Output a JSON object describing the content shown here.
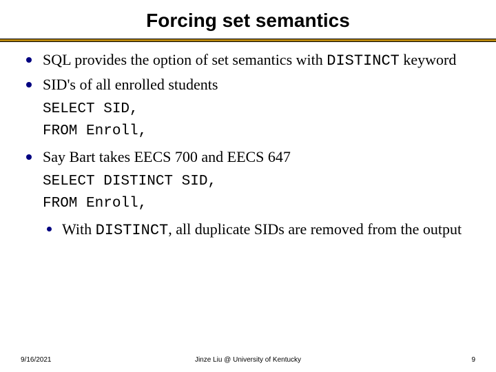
{
  "title": "Forcing set semantics",
  "bullets": {
    "b1_pre": "SQL provides the option of set semantics with ",
    "b1_code": "DISTINCT",
    "b1_post": " keyword",
    "b2": "SID's of all enrolled students",
    "code1_l1": "SELECT SID,",
    "code1_l2": "FROM Enroll,",
    "b3": "Say Bart takes EECS 700 and EECS 647",
    "code2_l1": "SELECT DISTINCT SID,",
    "code2_l2": "FROM Enroll,",
    "sub_pre": "With ",
    "sub_code": "DISTINCT",
    "sub_post": ", all duplicate SIDs are removed from the output"
  },
  "footer": {
    "date": "9/16/2021",
    "center": "Jinze Liu @ University of Kentucky",
    "page": "9"
  }
}
